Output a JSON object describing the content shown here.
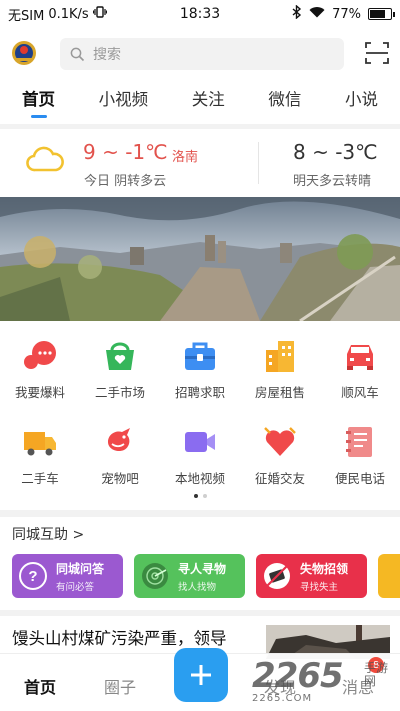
{
  "status_bar": {
    "carrier": "无SIM",
    "speed": "0.1K/s",
    "time": "18:33",
    "battery": "77%",
    "battery_level": 0.77
  },
  "search": {
    "placeholder": "搜索"
  },
  "tabs": [
    "首页",
    "小视频",
    "关注",
    "微信",
    "小说"
  ],
  "weather": {
    "today_temp": "9 ~ -1℃",
    "city": "洛南",
    "today_desc": "今日 阴转多云",
    "tomorrow_temp": "8 ~ -3℃",
    "tomorrow_desc": "明天多云转晴"
  },
  "grid": [
    {
      "label": "我要爆料",
      "icon": "chat-bubbles-icon",
      "color": "#f0494a"
    },
    {
      "label": "二手市场",
      "icon": "shopping-basket-icon",
      "color": "#35b65a"
    },
    {
      "label": "招聘求职",
      "icon": "briefcase-icon",
      "color": "#3d8ef2"
    },
    {
      "label": "房屋租售",
      "icon": "buildings-icon",
      "color": "#f5a623"
    },
    {
      "label": "顺风车",
      "icon": "car-icon",
      "color": "#f0494a"
    },
    {
      "label": "二手车",
      "icon": "truck-icon",
      "color": "#f5a623"
    },
    {
      "label": "宠物吧",
      "icon": "bird-icon",
      "color": "#f0494a"
    },
    {
      "label": "本地视频",
      "icon": "video-camera-icon",
      "color": "#8a6cf0"
    },
    {
      "label": "征婚交友",
      "icon": "heart-icon",
      "color": "#f0494a"
    },
    {
      "label": "便民电话",
      "icon": "phonebook-icon",
      "color": "#f08a8a"
    }
  ],
  "help": {
    "title": "同城互助 >",
    "cards": [
      {
        "title": "同城问答",
        "sub": "有问必答",
        "color": "#9b59d0",
        "icon": "question-icon"
      },
      {
        "title": "寻人寻物",
        "sub": "找人找物",
        "color": "#55c25c",
        "icon": "radar-icon"
      },
      {
        "title": "失物招领",
        "sub": "寻找失主",
        "color": "#e8304a",
        "icon": "wallet-icon"
      }
    ]
  },
  "news": {
    "title": "馒头山村煤矿污染严重，领导"
  },
  "bottom_nav": {
    "home": "首页",
    "circle": "圈子",
    "discover": "发现",
    "messages": "消息",
    "badge": "8"
  },
  "watermark": {
    "number": "2265",
    "sub": "2265.COM",
    "cn1": "手游",
    "cn2": "网"
  }
}
